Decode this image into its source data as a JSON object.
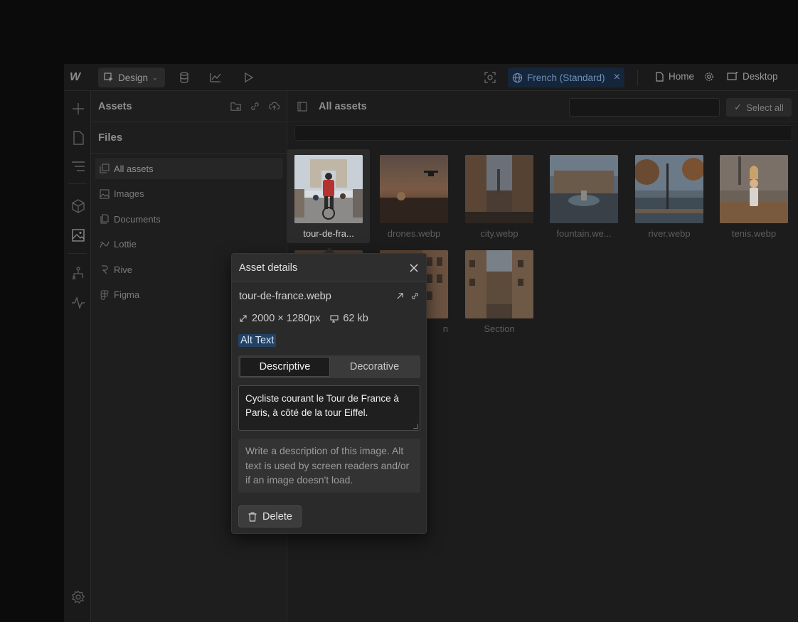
{
  "topbar": {
    "logo": "W",
    "mode_label": "Design",
    "language_label": "French (Standard)",
    "page_label": "Home",
    "breakpoint_label": "Desktop"
  },
  "panel": {
    "title": "Assets",
    "files_title": "Files",
    "items": [
      {
        "label": "All assets",
        "icon": "all-assets-icon"
      },
      {
        "label": "Images",
        "icon": "image-icon"
      },
      {
        "label": "Documents",
        "icon": "document-icon"
      },
      {
        "label": "Lottie",
        "icon": "lottie-icon"
      },
      {
        "label": "Rive",
        "icon": "rive-icon"
      },
      {
        "label": "Figma",
        "icon": "figma-icon"
      }
    ]
  },
  "main": {
    "title": "All assets",
    "select_all_label": "Select all",
    "assets": [
      {
        "name": "tour-de-fra...",
        "selected": true
      },
      {
        "name": "drones.webp"
      },
      {
        "name": "city.webp"
      },
      {
        "name": "fountain.we..."
      },
      {
        "name": "river.webp"
      },
      {
        "name": "tenis.webp"
      },
      {
        "name": ""
      },
      {
        "name": "n"
      },
      {
        "name": "Section"
      }
    ]
  },
  "popover": {
    "title": "Asset details",
    "file_name": "tour-de-france.webp",
    "dimensions": "2000 × 1280px",
    "file_size": "62 kb",
    "alt_label": "Alt Text",
    "tabs": [
      {
        "label": "Descriptive",
        "active": true
      },
      {
        "label": "Decorative",
        "active": false
      }
    ],
    "alt_text_value": "Cycliste courant le Tour de France à Paris, à côté de la tour Eiffel.",
    "hint": "Write a description of this image. Alt text is used by screen readers and/or if an image doesn't load.",
    "delete_label": "Delete"
  },
  "colors": {
    "accent": "#224264",
    "language_pill": "#16263a",
    "background": "#1e1e1e"
  }
}
